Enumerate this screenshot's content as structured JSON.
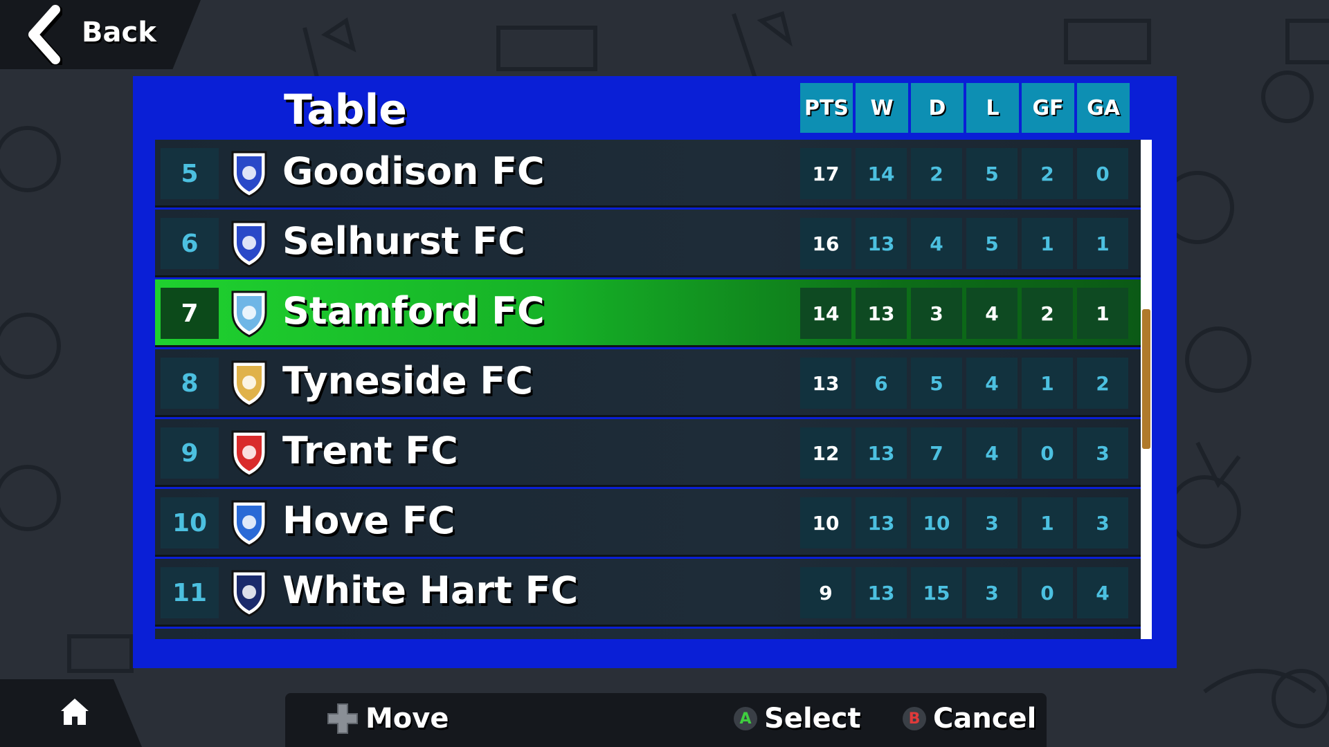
{
  "nav": {
    "back_label": "Back"
  },
  "table": {
    "title": "Table",
    "columns": [
      "PTS",
      "W",
      "D",
      "L",
      "GF",
      "GA"
    ],
    "rows": [
      {
        "pos": "5",
        "team": "Goodison FC",
        "crest": "castle-crest-icon",
        "crest_color": "#2a49c8",
        "pts": "17",
        "w": "14",
        "d": "2",
        "l": "5",
        "gf": "2",
        "ga": "0",
        "selected": false
      },
      {
        "pos": "6",
        "team": "Selhurst FC",
        "crest": "eagle-crest-icon",
        "crest_color": "#2a49c8",
        "pts": "16",
        "w": "13",
        "d": "4",
        "l": "5",
        "gf": "1",
        "ga": "1",
        "selected": false
      },
      {
        "pos": "7",
        "team": "Stamford FC",
        "crest": "lion-crest-icon",
        "crest_color": "#6fb6e6",
        "pts": "14",
        "w": "13",
        "d": "3",
        "l": "4",
        "gf": "2",
        "ga": "1",
        "selected": true
      },
      {
        "pos": "8",
        "team": "Tyneside FC",
        "crest": "seahorse-crest-icon",
        "crest_color": "#e0b24a",
        "pts": "13",
        "w": "6",
        "d": "5",
        "l": "4",
        "gf": "1",
        "ga": "2",
        "selected": false
      },
      {
        "pos": "9",
        "team": "Trent FC",
        "crest": "tree-crest-icon",
        "crest_color": "#d92b2b",
        "pts": "12",
        "w": "13",
        "d": "7",
        "l": "4",
        "gf": "0",
        "ga": "3",
        "selected": false
      },
      {
        "pos": "10",
        "team": "Hove FC",
        "crest": "seagull-crest-icon",
        "crest_color": "#2a6ad6",
        "pts": "10",
        "w": "13",
        "d": "10",
        "l": "3",
        "gf": "1",
        "ga": "3",
        "selected": false
      },
      {
        "pos": "11",
        "team": "White Hart FC",
        "crest": "cockerel-crest-icon",
        "crest_color": "#1b2a6b",
        "pts": "9",
        "w": "13",
        "d": "15",
        "l": "3",
        "gf": "0",
        "ga": "4",
        "selected": false
      }
    ],
    "scroll": {
      "position_fraction": 0.34,
      "visible_fraction": 0.28
    }
  },
  "controls": {
    "move_label": "Move",
    "select_label": "Select",
    "select_button": "A",
    "cancel_label": "Cancel",
    "cancel_button": "B"
  },
  "colors": {
    "panel": "#0a1fd6",
    "selected_row": "#1fd12f",
    "header_cell": "#0d8fb3",
    "a_button": "#3fcf3f",
    "b_button": "#e03a3a"
  }
}
